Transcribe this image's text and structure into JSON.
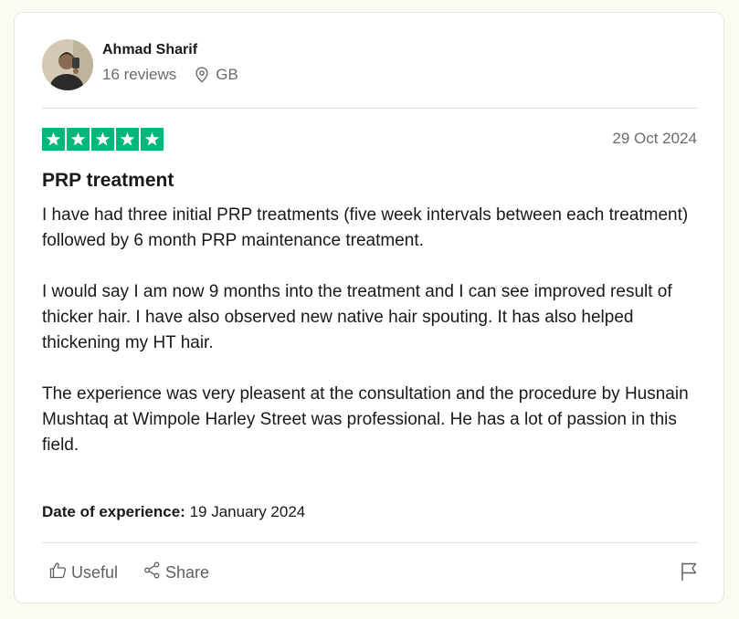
{
  "author": {
    "name": "Ahmad Sharif",
    "reviews": "16 reviews",
    "country": "GB"
  },
  "review": {
    "rating": 5,
    "date": "29 Oct 2024",
    "title": "PRP treatment",
    "paragraphs": [
      "I have had three initial PRP treatments (five week intervals between each treatment) followed by 6 month PRP maintenance treatment.",
      "I would say I am now 9 months into the treatment and I can see improved result of thicker hair. I have also observed new native hair spouting. It has also helped thickening my HT hair.",
      "The experience was very pleasent at the consultation and the procedure by Husnain Mushtaq at Wimpole Harley Street was professional. He has a lot of passion in this field."
    ],
    "experience_label": "Date of experience:",
    "experience_date": "19 January 2024"
  },
  "actions": {
    "useful": "Useful",
    "share": "Share"
  },
  "colors": {
    "star_green": "#00b67a",
    "text": "#191919",
    "muted": "#6b6b6b"
  }
}
